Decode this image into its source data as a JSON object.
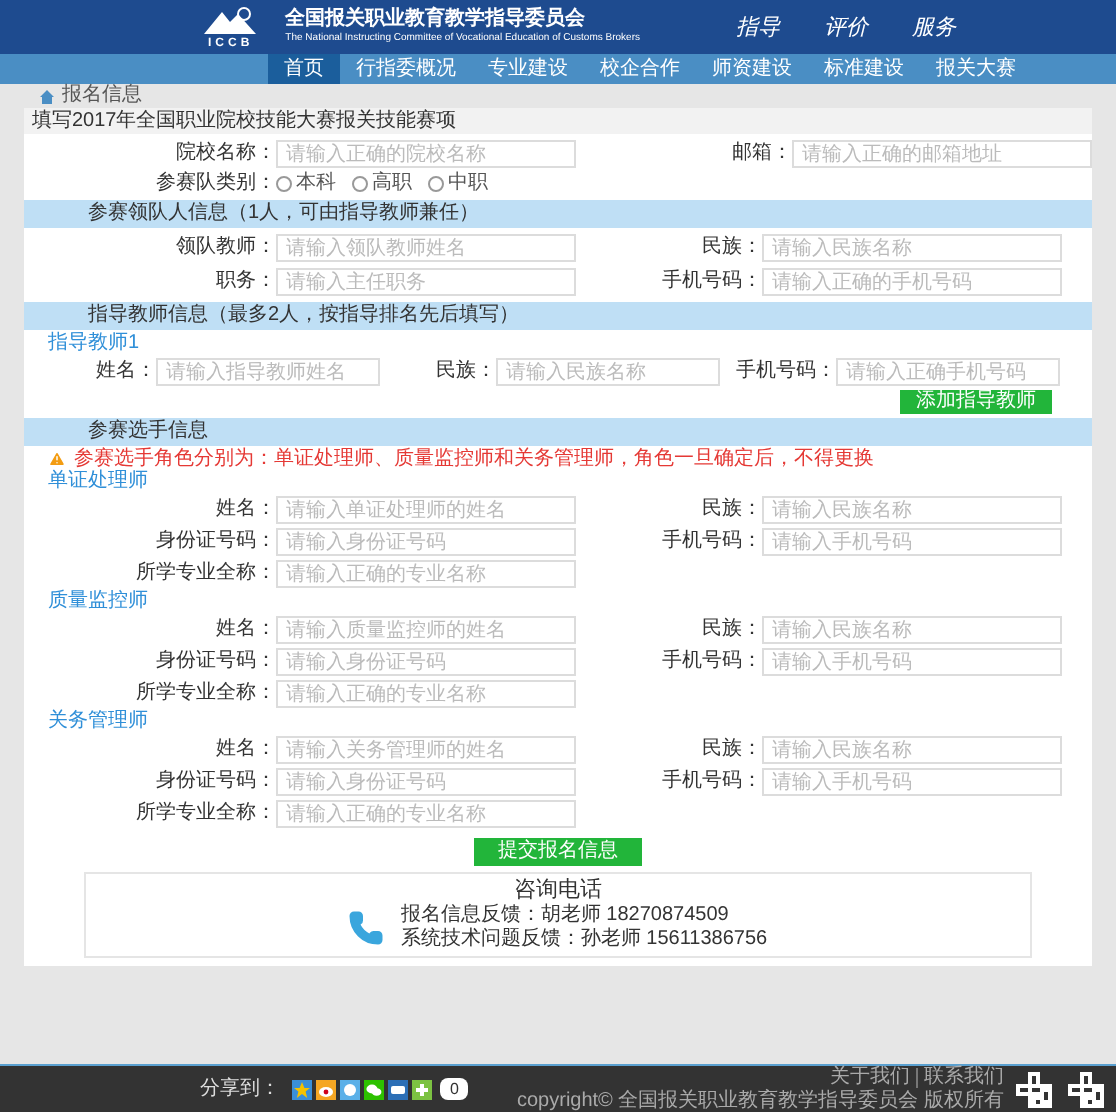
{
  "header": {
    "logo_text": "ICCB",
    "title": "全国报关职业教育教学指导委员会",
    "subtitle": "The National Instructing Committee of Vocational Education of Customs Brokers",
    "slogans": [
      "指导",
      "评价",
      "服务"
    ]
  },
  "nav": [
    {
      "label": "首页",
      "selected": true
    },
    {
      "label": "行指委概况",
      "selected": false
    },
    {
      "label": "专业建设",
      "selected": false
    },
    {
      "label": "校企合作",
      "selected": false
    },
    {
      "label": "师资建设",
      "selected": false
    },
    {
      "label": "标准建设",
      "selected": false
    },
    {
      "label": "报关大赛",
      "selected": false
    }
  ],
  "breadcrumb": "报名信息",
  "form": {
    "title": "填写2017年全国职业院校技能大赛报关技能赛项",
    "school_fields": [
      {
        "label": "院校名称：",
        "placeholder": "请输入正确的院校名称"
      },
      {
        "label": "邮箱：",
        "placeholder": "请输入正确的邮箱地址"
      }
    ],
    "team_type": {
      "label": "参赛队类别：",
      "options": [
        {
          "label": "本科",
          "selected": false
        },
        {
          "label": "高职",
          "selected": false
        },
        {
          "label": "中职",
          "selected": false
        }
      ]
    },
    "leader": {
      "heading": "参赛领队人信息（1人，可由指导教师兼任）",
      "fields": [
        {
          "label": "领队教师：",
          "placeholder": "请输入领队教师姓名"
        },
        {
          "label": "民族：",
          "placeholder": "请输入民族名称"
        },
        {
          "label": "职务：",
          "placeholder": "请输入主任职务"
        },
        {
          "label": "手机号码：",
          "placeholder": "请输入正确的手机号码"
        }
      ]
    },
    "teachers": {
      "heading": "指导教师信息（最多2人，按指导排名先后填写）",
      "subheading": "指导教师1",
      "fields": [
        {
          "label": "姓名：",
          "placeholder": "请输入指导教师姓名"
        },
        {
          "label": "民族：",
          "placeholder": "请输入民族名称"
        },
        {
          "label": "手机号码：",
          "placeholder": "请输入正确手机号码"
        }
      ],
      "add_button": "添加指导教师"
    },
    "contestants": {
      "heading": "参赛选手信息",
      "warning": "参赛选手角色分别为：单证处理师、质量监控师和关务管理师，角色一旦确定后，不得更换",
      "groups": [
        {
          "title": "单证处理师",
          "fields": [
            {
              "label": "姓名：",
              "placeholder": "请输入单证处理师的姓名"
            },
            {
              "label": "民族：",
              "placeholder": "请输入民族名称"
            },
            {
              "label": "身份证号码：",
              "placeholder": "请输入身份证号码"
            },
            {
              "label": "手机号码：",
              "placeholder": "请输入手机号码"
            },
            {
              "label": "所学专业全称：",
              "placeholder": "请输入正确的专业名称"
            }
          ]
        },
        {
          "title": "质量监控师",
          "fields": [
            {
              "label": "姓名：",
              "placeholder": "请输入质量监控师的姓名"
            },
            {
              "label": "民族：",
              "placeholder": "请输入民族名称"
            },
            {
              "label": "身份证号码：",
              "placeholder": "请输入身份证号码"
            },
            {
              "label": "手机号码：",
              "placeholder": "请输入手机号码"
            },
            {
              "label": "所学专业全称：",
              "placeholder": "请输入正确的专业名称"
            }
          ]
        },
        {
          "title": "关务管理师",
          "fields": [
            {
              "label": "姓名：",
              "placeholder": "请输入关务管理师的姓名"
            },
            {
              "label": "民族：",
              "placeholder": "请输入民族名称"
            },
            {
              "label": "身份证号码：",
              "placeholder": "请输入身份证号码"
            },
            {
              "label": "手机号码：",
              "placeholder": "请输入手机号码"
            },
            {
              "label": "所学专业全称：",
              "placeholder": "请输入正确的专业名称"
            }
          ]
        }
      ]
    },
    "submit_button": "提交报名信息"
  },
  "contact": {
    "title": "咨询电话",
    "lines": [
      "报名信息反馈：胡老师 18270874509",
      "系统技术问题反馈：孙老师 15611386756"
    ]
  },
  "footer": {
    "share_label": "分享到：",
    "share_count": "0",
    "links": [
      "关于我们",
      "联系我们"
    ],
    "copyright": "copyright© 全国报关职业教育教学指导委员会 版权所有"
  }
}
